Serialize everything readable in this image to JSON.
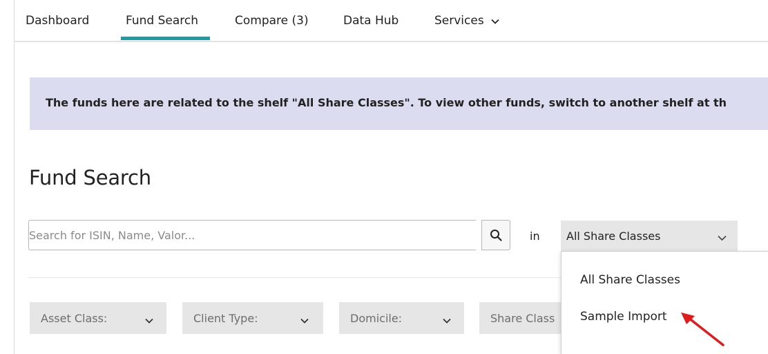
{
  "nav": {
    "tabs": [
      {
        "label": "Dashboard"
      },
      {
        "label": "Fund Search",
        "active": true
      },
      {
        "label": "Compare (3)"
      },
      {
        "label": "Data Hub"
      },
      {
        "label": "Services"
      }
    ],
    "active_color": "#1f9aa7"
  },
  "banner": {
    "text": "The funds here are related to the shelf \"All Share Classes\". To view other funds, switch to another shelf at th",
    "background": "#dcdcf0"
  },
  "page": {
    "title": "Fund Search"
  },
  "search": {
    "placeholder": "Search for ISIN, Name, Valor...",
    "value": "",
    "button_icon": "search-icon",
    "in_label": "in",
    "shelf_selected": "All Share Classes"
  },
  "filters": [
    {
      "label": "Asset Class:"
    },
    {
      "label": "Client Type:"
    },
    {
      "label": "Domicile:"
    },
    {
      "label": "Share Class"
    }
  ],
  "dropdown": {
    "options": [
      {
        "label": "All Share Classes"
      },
      {
        "label": "Sample Import"
      }
    ]
  },
  "annotation": {
    "arrow_color": "#e01b1b"
  }
}
